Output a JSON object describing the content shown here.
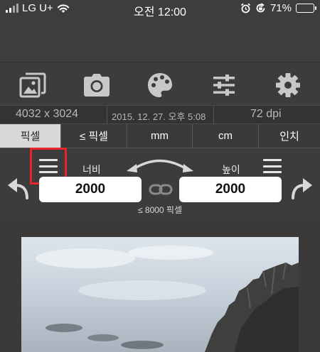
{
  "status_bar": {
    "carrier": "LG U+",
    "time": "오전 12:00",
    "battery": "71%",
    "battery_level": 0.71
  },
  "toolbar": {
    "icons": [
      "photo-library-icon",
      "camera-icon",
      "palette-icon",
      "sliders-icon",
      "gear-icon"
    ]
  },
  "image_info": {
    "resolution": "4032 x 3024",
    "date": "2015. 12. 27. 오후 5:08",
    "dpi": "72 dpi"
  },
  "unit_tabs": [
    {
      "label": "픽셀",
      "active": true
    },
    {
      "label": "≤ 픽셀",
      "active": false
    },
    {
      "label": "mm",
      "active": false
    },
    {
      "label": "cm",
      "active": false
    },
    {
      "label": "인치",
      "active": false
    }
  ],
  "dimensions": {
    "width_label": "너비",
    "width_value": "2000",
    "height_label": "높이",
    "height_value": "2000",
    "limit_text": "≤ 8000 픽셀"
  },
  "colors": {
    "background": "#3a3a3a",
    "active_tab": "#d8d8d8",
    "highlight_box": "#e8252a",
    "battery_green": "#4cd964"
  }
}
